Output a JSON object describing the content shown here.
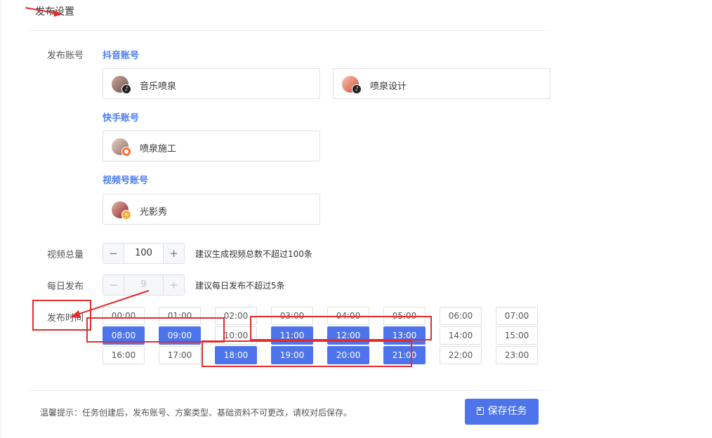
{
  "page": {
    "title": "发布设置"
  },
  "labels": {
    "accounts": "发布账号",
    "video_total": "视频总量",
    "daily_publish": "每日发布",
    "publish_time": "发布时间"
  },
  "groups": [
    {
      "title": "抖音账号",
      "platform": "douyin",
      "accounts": [
        "音乐喷泉",
        "喷泉设计"
      ]
    },
    {
      "title": "快手账号",
      "platform": "kuaishou",
      "accounts": [
        "喷泉施工"
      ]
    },
    {
      "title": "视频号账号",
      "platform": "shipin",
      "accounts": [
        "光影秀"
      ]
    }
  ],
  "video_total": {
    "value": "100",
    "hint": "建议生成视频总数不超过100条"
  },
  "daily_publish": {
    "value": "9",
    "hint": "建议每日发布不超过5条",
    "disabled": true
  },
  "times": [
    {
      "label": "00:00",
      "selected": false
    },
    {
      "label": "01:00",
      "selected": false
    },
    {
      "label": "02:00",
      "selected": false
    },
    {
      "label": "03:00",
      "selected": false
    },
    {
      "label": "04:00",
      "selected": false
    },
    {
      "label": "05:00",
      "selected": false
    },
    {
      "label": "06:00",
      "selected": false
    },
    {
      "label": "07:00",
      "selected": false
    },
    {
      "label": "08:00",
      "selected": true
    },
    {
      "label": "09:00",
      "selected": true
    },
    {
      "label": "10:00",
      "selected": false
    },
    {
      "label": "11:00",
      "selected": true
    },
    {
      "label": "12:00",
      "selected": true
    },
    {
      "label": "13:00",
      "selected": true
    },
    {
      "label": "14:00",
      "selected": false
    },
    {
      "label": "15:00",
      "selected": false
    },
    {
      "label": "16:00",
      "selected": false
    },
    {
      "label": "17:00",
      "selected": false
    },
    {
      "label": "18:00",
      "selected": true
    },
    {
      "label": "19:00",
      "selected": true
    },
    {
      "label": "20:00",
      "selected": true
    },
    {
      "label": "21:00",
      "selected": true
    },
    {
      "label": "22:00",
      "selected": false
    },
    {
      "label": "23:00",
      "selected": false
    }
  ],
  "footer": {
    "tip": "温馨提示：任务创建后，发布账号、方案类型、基础资料不可更改，请校对后保存。",
    "save_label": "保存任务"
  },
  "colors": {
    "accent": "#4e74ec",
    "link": "#4a7cf0",
    "annotation": "#e52b2b"
  }
}
